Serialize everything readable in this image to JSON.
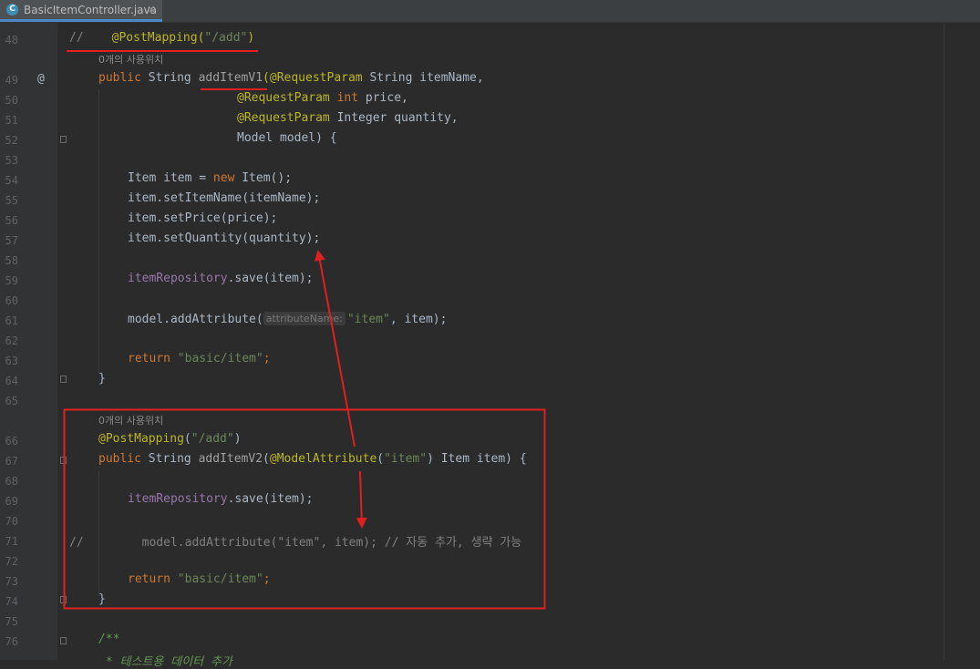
{
  "tab": {
    "icon_letter": "C",
    "filename": "BasicItemController.java",
    "close": "×"
  },
  "lines": {
    "l48": "48",
    "l49": "49",
    "l50": "50",
    "l51": "51",
    "l52": "52",
    "l53": "53",
    "l54": "54",
    "l55": "55",
    "l56": "56",
    "l57": "57",
    "l58": "58",
    "l59": "59",
    "l60": "60",
    "l61": "61",
    "l62": "62",
    "l63": "63",
    "l64": "64",
    "l65": "65",
    "l66": "66",
    "l67": "67",
    "l68": "68",
    "l69": "69",
    "l70": "70",
    "l71": "71",
    "l72": "72",
    "l73": "73",
    "l74": "74",
    "l75": "75",
    "l76": "76"
  },
  "gutter_marker": "@",
  "usage_hint_1": "0개의 사용위치",
  "usage_hint_2": "0개의 사용위치",
  "code": {
    "c48_comment": "//",
    "c48_annotation": "@PostMapping(",
    "c48_path": "\"/add\"",
    "c48_close": ")",
    "c49_public": "public",
    "c49_type": " String ",
    "c49_method": "addItemV1",
    "c49_paren": "(",
    "c49_ann": "@RequestParam",
    "c49_rest": " String itemName,",
    "c50_ann": "@RequestParam",
    "c50_int": " int",
    "c50_rest": " price,",
    "c51_ann": "@RequestParam",
    "c51_rest": " Integer quantity,",
    "c52": "Model model) {",
    "c54_a": "Item item = ",
    "c54_new": "new",
    "c54_b": " Item();",
    "c55": "item.setItemName(itemName);",
    "c56": "item.setPrice(price);",
    "c57": "item.setQuantity(quantity);",
    "c59_field": "itemRepository",
    "c59_rest": ".save(item);",
    "c61_a": "model.addAttribute(",
    "c61_inlay": "attributeName:",
    "c61_str": "\"item\"",
    "c61_b": ", item);",
    "c63_return": "return",
    "c63_str": " \"basic/item\"",
    "c63_semi": ";",
    "c64": "}",
    "c66_ann": "@PostMapping",
    "c66_open": "(",
    "c66_str": "\"/add\"",
    "c66_close": ")",
    "c67_public": "public",
    "c67_type": " String ",
    "c67_method": "addItemV2",
    "c67_paren": "(",
    "c67_ann": "@ModelAttribute",
    "c67_open": "(",
    "c67_str": "\"item\"",
    "c67_rest": ") Item item) {",
    "c69_field": "itemRepository",
    "c69_rest": ".save(item);",
    "c71_slash": "//",
    "c71_code": "model.addAttribute(\"item\", item); // 자동 추가, 생략 가능",
    "c73_return": "return",
    "c73_str": " \"basic/item\"",
    "c73_semi": ";",
    "c74": "}",
    "c76": "/**",
    "c77": " * 테스트용 데이터 추가"
  },
  "colors": {
    "background": "#2b2b2b",
    "gutter": "#313335",
    "keyword": "#cc7832",
    "annotation": "#bbb529",
    "string": "#6a8759",
    "field": "#9876aa",
    "comment": "#808080",
    "overlay_red": "#e02020"
  }
}
